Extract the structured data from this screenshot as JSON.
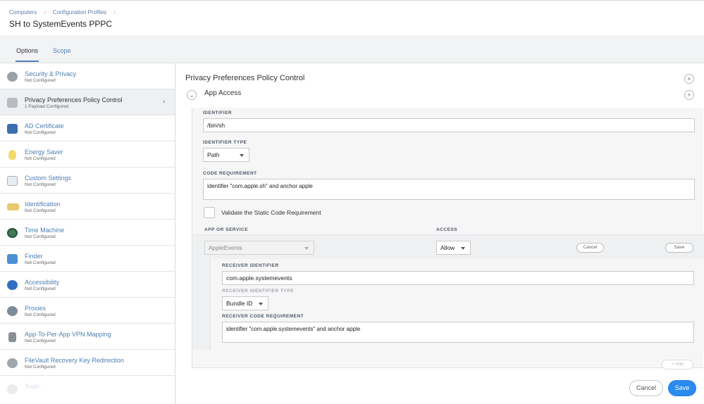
{
  "breadcrumb": {
    "items": [
      "Computers",
      "Configuration Profiles"
    ]
  },
  "page_title": "SH to SystemEvents PPPC",
  "tabs": [
    {
      "label": "Options",
      "active": true
    },
    {
      "label": "Scope",
      "active": false
    }
  ],
  "sidebar": {
    "items": [
      {
        "label": "Security & Privacy",
        "status": "Not Configured",
        "icon": "shield-lock-icon"
      },
      {
        "label": "Privacy Preferences Policy Control",
        "status": "1 Payload Configured",
        "icon": "privacy-shield-icon",
        "selected": true
      },
      {
        "label": "AD Certificate",
        "status": "Not Configured",
        "icon": "certificate-icon"
      },
      {
        "label": "Energy Saver",
        "status": "Not Configured",
        "icon": "lightbulb-icon"
      },
      {
        "label": "Custom Settings",
        "status": "Not Configured",
        "icon": "custom-settings-icon"
      },
      {
        "label": "Identification",
        "status": "Not Configured",
        "icon": "id-card-icon"
      },
      {
        "label": "Time Machine",
        "status": "Not Configured",
        "icon": "time-machine-icon"
      },
      {
        "label": "Finder",
        "status": "Not Configured",
        "icon": "finder-icon"
      },
      {
        "label": "Accessibility",
        "status": "Not Configured",
        "icon": "accessibility-icon"
      },
      {
        "label": "Proxies",
        "status": "Not Configured",
        "icon": "globe-icon"
      },
      {
        "label": "App-To-Per-App VPN Mapping",
        "status": "Not Configured",
        "icon": "lock-icon"
      },
      {
        "label": "FileVault Recovery Key Redirection",
        "status": "Not Configured",
        "icon": "filevault-icon"
      },
      {
        "label": "Xsan",
        "status": "",
        "icon": "xsan-icon"
      }
    ]
  },
  "main": {
    "section_title": "Privacy Preferences Policy Control",
    "app_access_label": "App Access",
    "close_symbol": "×",
    "add_symbol": "+",
    "collapse_symbol": "⌄",
    "identifier": {
      "label": "IDENTIFIER",
      "value": "/bin/sh"
    },
    "identifier_type": {
      "label": "IDENTIFIER TYPE",
      "value": "Path"
    },
    "code_requirement": {
      "label": "CODE REQUIREMENT",
      "value": "identifier \"com.apple.sh\" and anchor apple"
    },
    "validate_label": "Validate the Static Code Requirement",
    "app_or_service": {
      "label": "APP OR SERVICE",
      "value": "AppleEvents"
    },
    "access": {
      "label": "ACCESS",
      "value": "Allow"
    },
    "row_cancel": "Cancel",
    "row_save": "Save",
    "receiver_identifier": {
      "label": "RECEIVER IDENTIFIER",
      "value": "com.apple.systemevents"
    },
    "receiver_identifier_type": {
      "label": "RECEIVER IDENTIFIER TYPE",
      "value": "Bundle ID"
    },
    "receiver_code_requirement": {
      "label": "RECEIVER CODE REQUIREMENT",
      "value": "identifier \"com.apple.systemevents\" and anchor apple"
    },
    "add_label": "+ Add"
  },
  "footer": {
    "cancel": "Cancel",
    "save": "Save"
  },
  "colors": {
    "accent": "#2b8af0",
    "link": "#4f7fb3"
  }
}
